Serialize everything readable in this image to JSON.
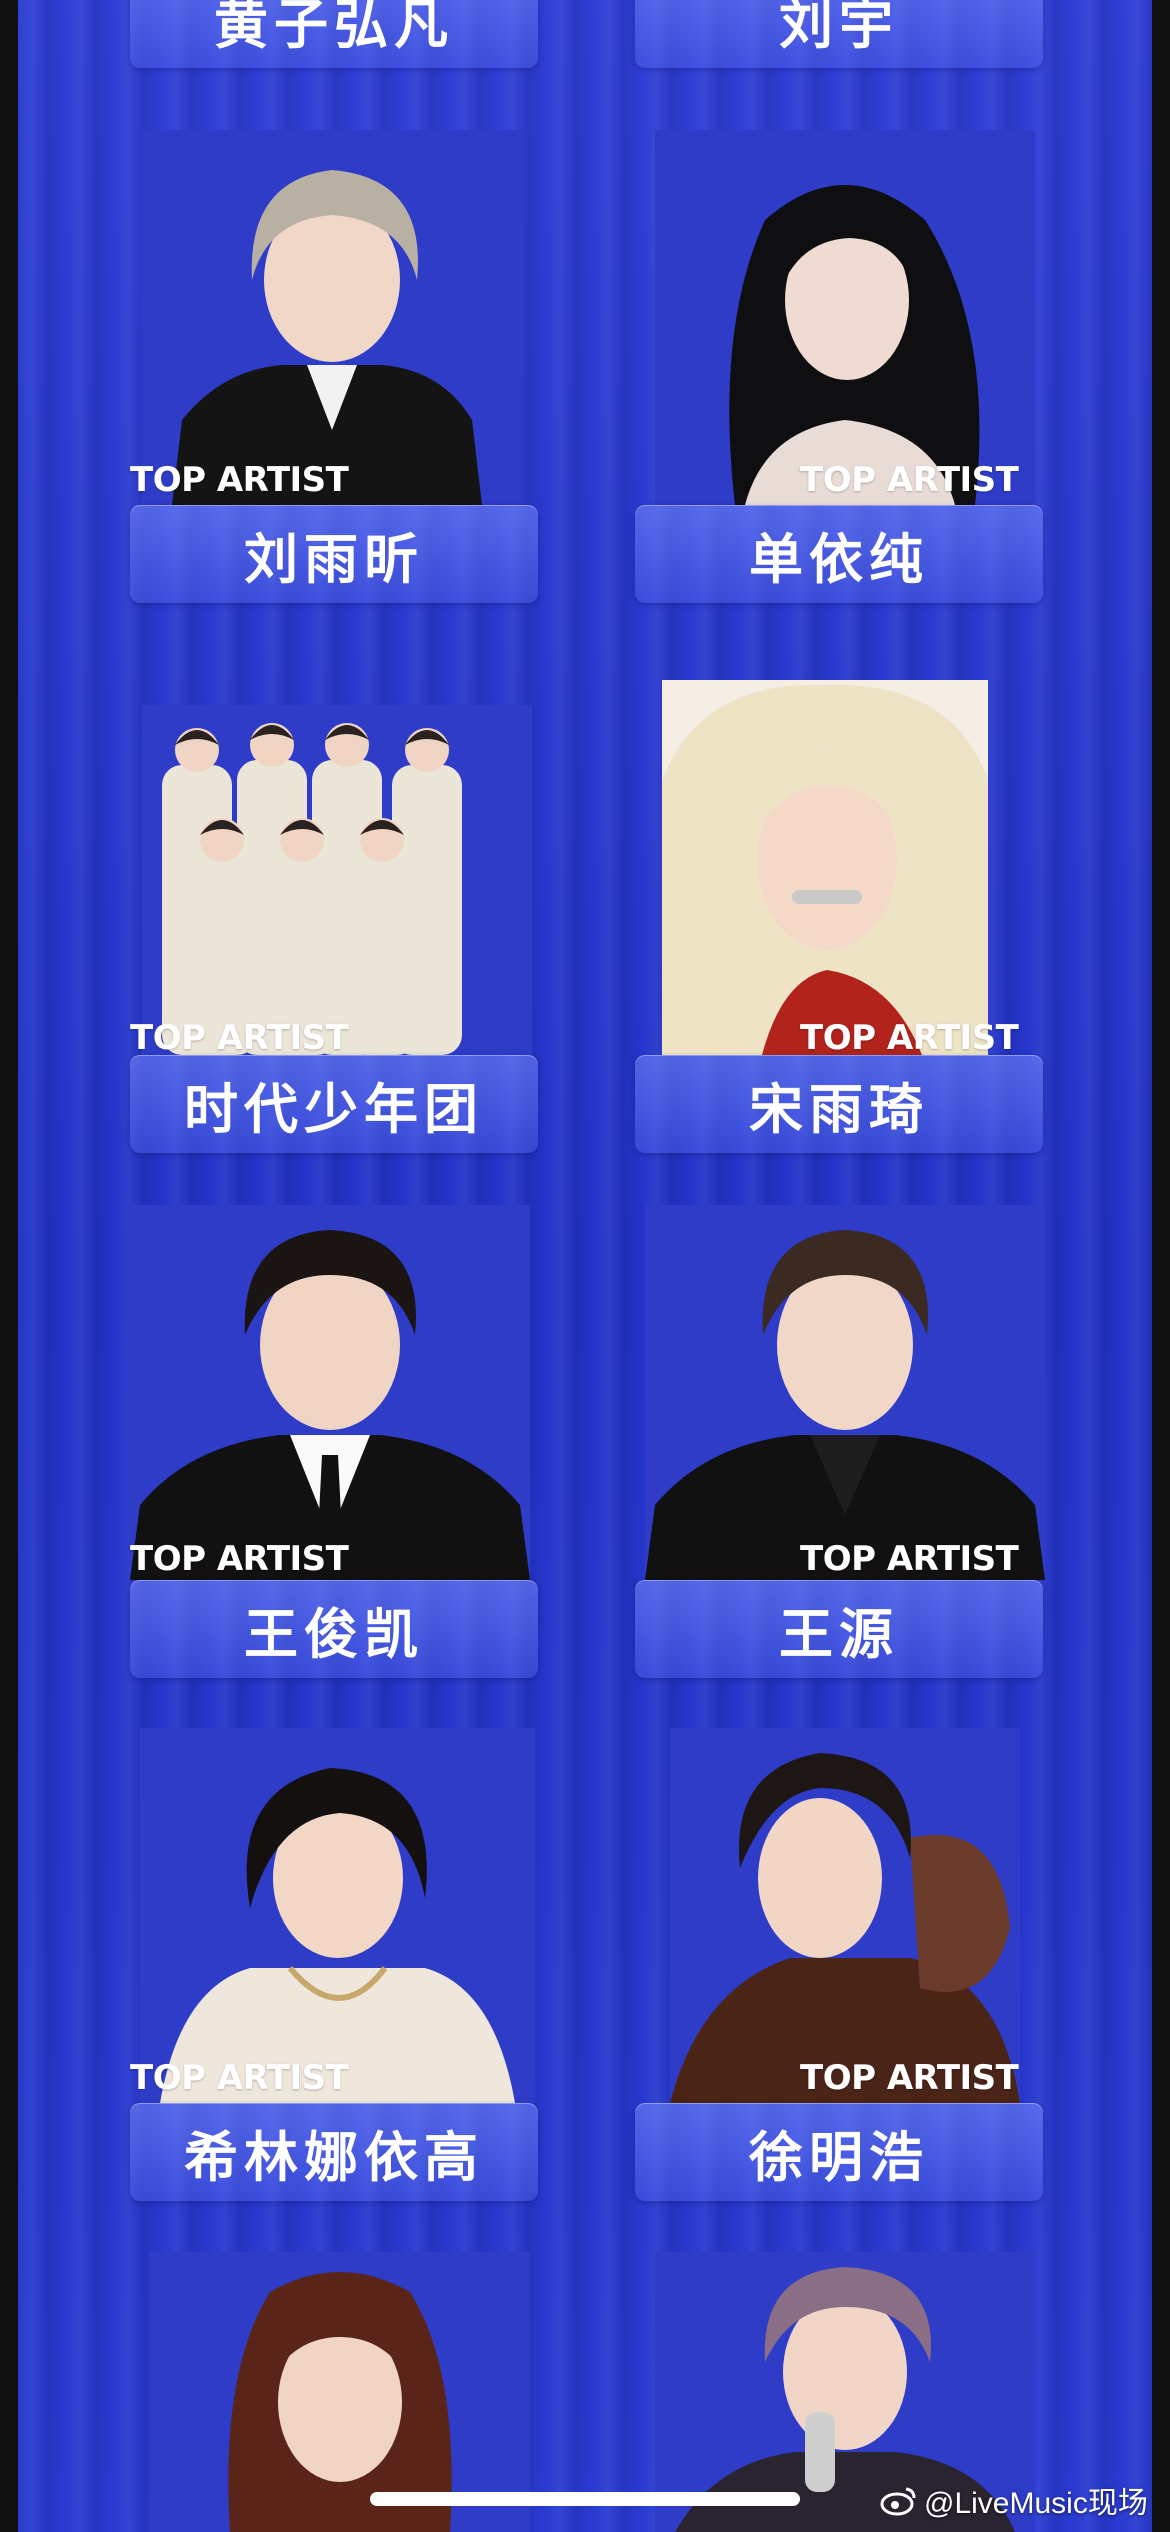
{
  "cards": [
    {
      "name": "黄子弘凡"
    },
    {
      "name": "刘宇"
    },
    {
      "name": "刘雨昕",
      "badge": "TOP ARTIST"
    },
    {
      "name": "单依纯",
      "badge": "TOP ARTIST"
    },
    {
      "name": "时代少年团",
      "badge": "TOP ARTIST"
    },
    {
      "name": "宋雨琦",
      "badge": "TOP ARTIST"
    },
    {
      "name": "王俊凯",
      "badge": "TOP ARTIST"
    },
    {
      "name": "王源",
      "badge": "TOP ARTIST"
    },
    {
      "name": "希林娜依高",
      "badge": "TOP ARTIST"
    },
    {
      "name": "徐明浩",
      "badge": "TOP ARTIST"
    }
  ],
  "watermark": {
    "text": "@LiveMusic现场",
    "icon": "weibo-icon"
  },
  "colors": {
    "background": "#2334c8",
    "plate": "#6a7ef0",
    "text": "#ffffff"
  }
}
